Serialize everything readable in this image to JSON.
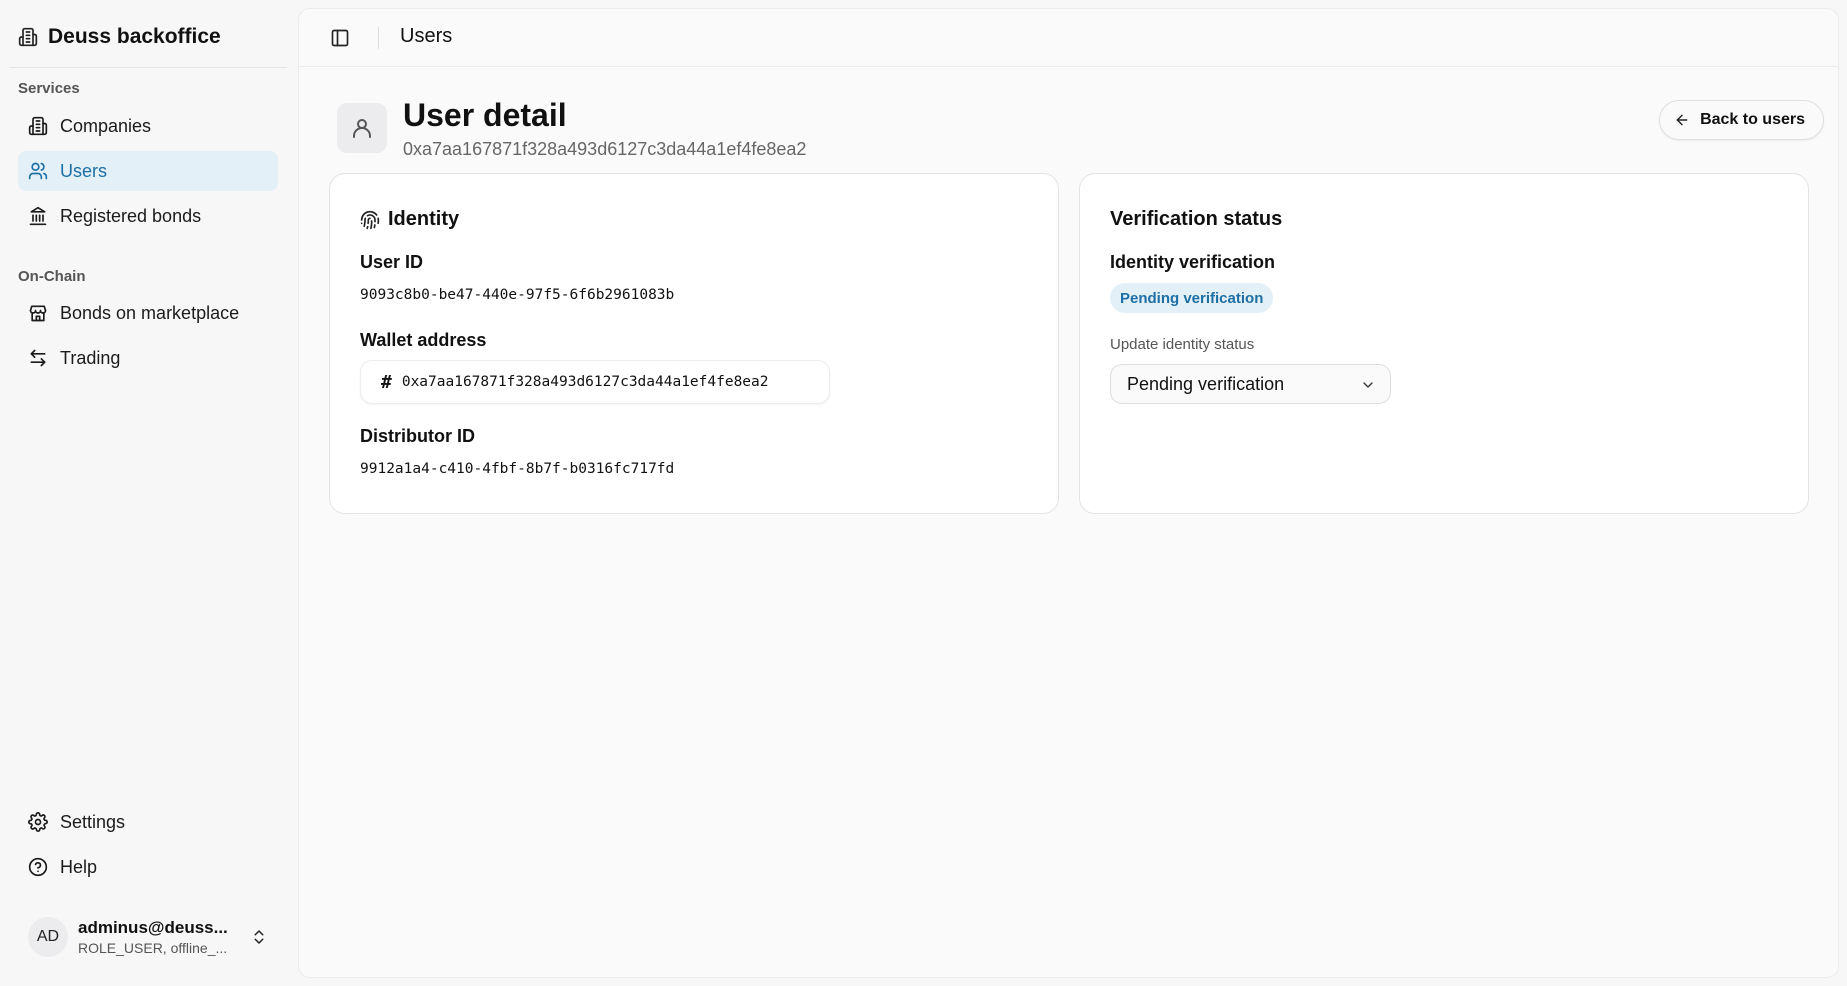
{
  "app": {
    "title": "Deuss backoffice"
  },
  "sidebar": {
    "sections": [
      {
        "label": "Services",
        "items": [
          {
            "label": "Companies",
            "icon": "building-icon"
          },
          {
            "label": "Users",
            "icon": "users-icon",
            "active": true
          },
          {
            "label": "Registered bonds",
            "icon": "landmark-icon"
          }
        ]
      },
      {
        "label": "On-Chain",
        "items": [
          {
            "label": "Bonds on marketplace",
            "icon": "store-icon"
          },
          {
            "label": "Trading",
            "icon": "arrows-left-right-icon"
          }
        ]
      }
    ],
    "footer_items": [
      {
        "label": "Settings",
        "icon": "gear-icon"
      },
      {
        "label": "Help",
        "icon": "help-circle-icon"
      }
    ],
    "user": {
      "initials": "AD",
      "email": "adminus@deuss...",
      "roles": "ROLE_USER, offline_..."
    }
  },
  "topbar": {
    "title": "Users"
  },
  "page": {
    "title": "User detail",
    "subtitle": "0xa7aa167871f328a493d6127c3da44a1ef4fe8ea2",
    "back_label": "Back to users"
  },
  "identity": {
    "title": "Identity",
    "user_id_label": "User ID",
    "user_id": "9093c8b0-be47-440e-97f5-6f6b2961083b",
    "wallet_label": "Wallet address",
    "wallet": "0xa7aa167871f328a493d6127c3da44a1ef4fe8ea2",
    "distributor_label": "Distributor ID",
    "distributor_id": "9912a1a4-c410-4fbf-8b7f-b0316fc717fd"
  },
  "verification": {
    "title": "Verification status",
    "identity_label": "Identity verification",
    "badge": "Pending verification",
    "update_label": "Update identity status",
    "selected": "Pending verification"
  },
  "colors": {
    "accent": "#1d6fa5",
    "accent_bg": "#e3f0f8"
  }
}
